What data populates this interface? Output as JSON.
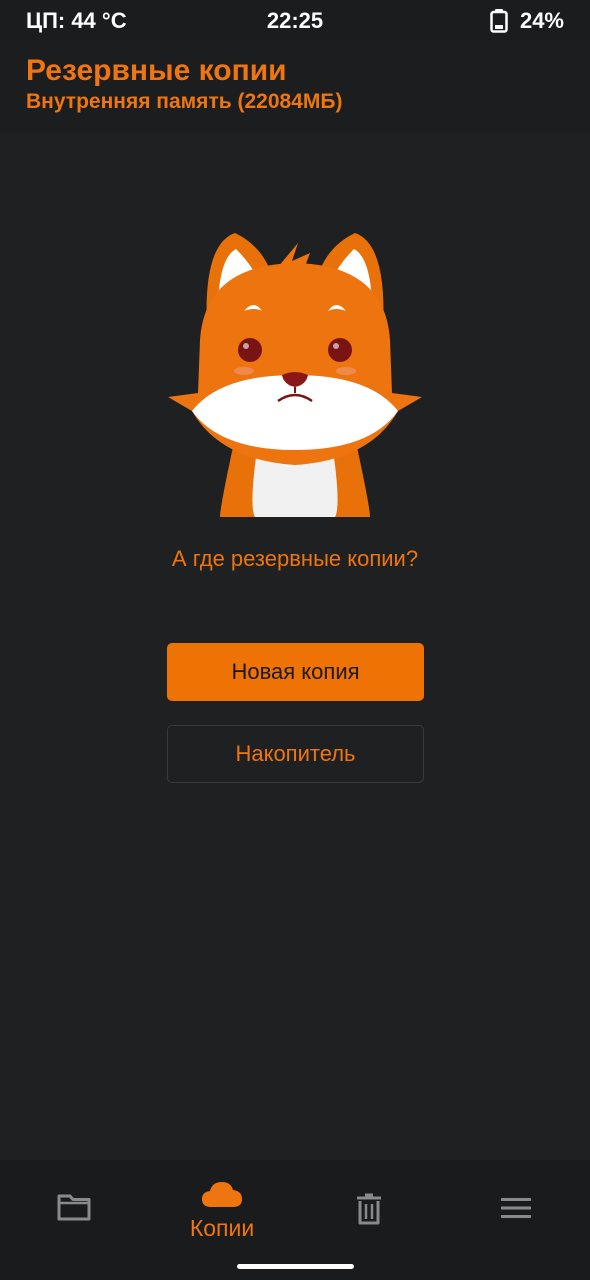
{
  "status_bar": {
    "cpu_temp": "ЦП: 44 °C",
    "time": "22:25",
    "battery": "24%"
  },
  "header": {
    "title": "Резервные копии",
    "subtitle": "Внутренняя память (22084МБ)"
  },
  "empty_state": {
    "message": "А где резервные копии?",
    "illustration": "sad-fox"
  },
  "actions": {
    "new_backup": "Новая копия",
    "storage": "Накопитель"
  },
  "bottom_nav": {
    "items": [
      {
        "icon": "folder-icon",
        "label": "",
        "active": false
      },
      {
        "icon": "cloud-icon",
        "label": "Копии",
        "active": true
      },
      {
        "icon": "trash-icon",
        "label": "",
        "active": false
      },
      {
        "icon": "menu-icon",
        "label": "",
        "active": false
      }
    ]
  },
  "colors": {
    "accent": "#ee7510",
    "background": "#1f2022",
    "inactive_icon": "#8a8a8a"
  }
}
